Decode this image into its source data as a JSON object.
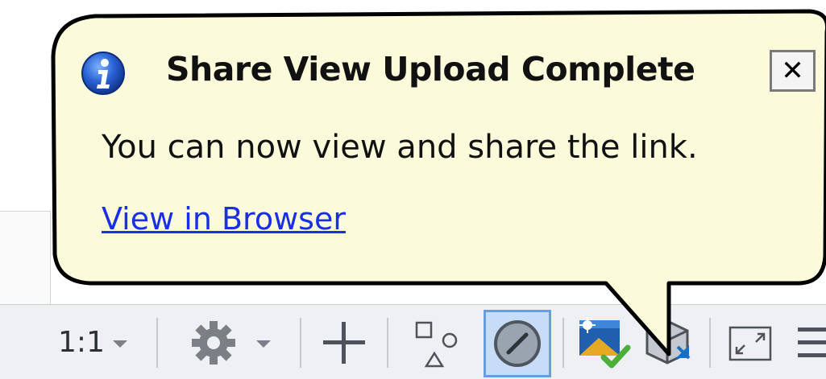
{
  "balloon": {
    "title": "Share View Upload Complete",
    "message": "You can now view and share the link.",
    "link_label": "View in Browser",
    "close_glyph": "✕",
    "icon": "info-icon",
    "background": "#fbfbdc",
    "border": "#000000"
  },
  "statusbar": {
    "scale_label": "1:1",
    "items": [
      {
        "name": "annotation-scale-dropdown",
        "icon": "scale-text"
      },
      {
        "name": "workspace-settings-gear",
        "icon": "gear-icon"
      },
      {
        "name": "add-plus-button",
        "icon": "plus-icon"
      },
      {
        "name": "isolate-objects-button",
        "icon": "shapes-icon"
      },
      {
        "name": "hardware-acceleration-button",
        "icon": "circle-slash-icon",
        "selected": true
      },
      {
        "name": "share-view-status-button",
        "icon": "share-view-check-icon"
      },
      {
        "name": "model-cube-button",
        "icon": "cube-arrow-icon"
      },
      {
        "name": "fullscreen-button",
        "icon": "fullscreen-icon"
      },
      {
        "name": "customize-menu-button",
        "icon": "menu-icon"
      }
    ],
    "accent": "#1a6fc4",
    "check_color": "#4caf3a"
  }
}
